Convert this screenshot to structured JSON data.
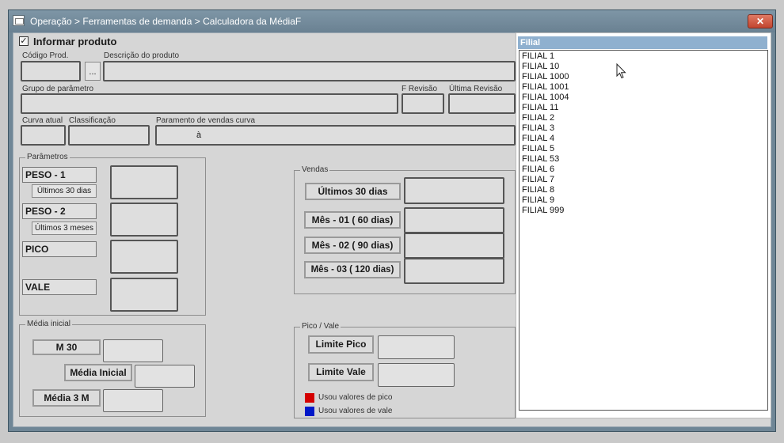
{
  "window": {
    "title": "Operação > Ferramentas de demanda > Calculadora da MédiaF",
    "close_symbol": "✕"
  },
  "form": {
    "informar_produto_label": "Informar produto",
    "informar_produto_checked": true,
    "codigo_prod_label": "Código Prod.",
    "descricao_label": "Descrição do  produto",
    "dots_button_label": "...",
    "grupo_parametro_label": "Grupo de parâmetro",
    "f_revisao_label": "F Revisão",
    "ultima_revisao_label": "Última Revisão",
    "curva_atual_label": "Curva atual",
    "classificacao_label": "Classificação",
    "parametro_vendas_curva_label": "Paramento de vendas curva",
    "parametro_vendas_curva_value": "à"
  },
  "parametros": {
    "title": "Parâmetros",
    "peso1": "PESO - 1",
    "peso1_sub": "Últimos 30 dias",
    "peso2": "PESO - 2",
    "peso2_sub": "Últimos 3 meses",
    "pico": "PICO",
    "vale": "VALE"
  },
  "vendas": {
    "title": "Vendas",
    "ultimos30": "Últimos 30 dias",
    "mes01": "Mês - 01 ( 60 dias)",
    "mes02": "Mês - 02 ( 90 dias)",
    "mes03": "Mês - 03 ( 120 dias)"
  },
  "media_inicial": {
    "title": "Média inicial",
    "m30": "M 30",
    "media_inicial": "Média Inicial",
    "media3m": "Média 3 M"
  },
  "pico_vale": {
    "title": "Pico / Vale",
    "limite_pico": "Limite Pico",
    "limite_vale": "Limite Vale",
    "legend_pico": "Usou valores de pico",
    "legend_vale": "Usou valores de vale",
    "color_pico": "#d40000",
    "color_vale": "#0018c8"
  },
  "filial_dropdown": {
    "header": "Filial",
    "items": [
      "FILIAL 1",
      "FILIAL 10",
      "FILIAL 1000",
      "FILIAL 1001",
      "FILIAL 1004",
      "FILIAL 11",
      "FILIAL 2",
      "FILIAL 3",
      "FILIAL 4",
      "FILIAL 5",
      "FILIAL 53",
      "FILIAL 6",
      "FILIAL 7",
      "FILIAL 8",
      "FILIAL 9",
      "FILIAL 999"
    ]
  }
}
